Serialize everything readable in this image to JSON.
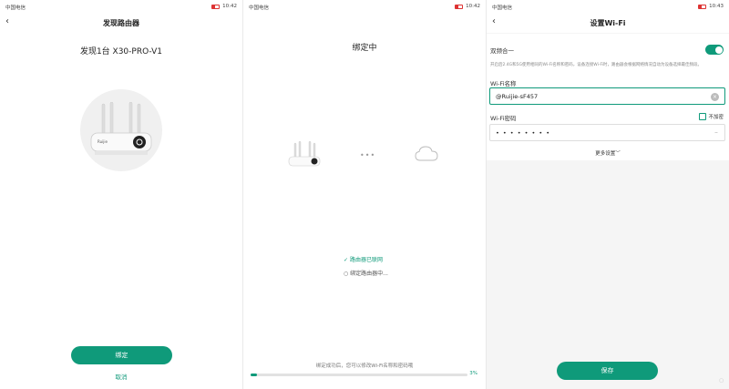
{
  "panel1": {
    "status": {
      "carrier": "中国电信",
      "time": "10:42"
    },
    "title": "发现路由器",
    "found_text": "发现1台 X30-PRO-V1",
    "router_brand": "Ruijie",
    "bind_button": "绑定",
    "cancel_link": "取消"
  },
  "panel2": {
    "status": {
      "carrier": "中国电信",
      "time": "10:42"
    },
    "title": "绑定中",
    "step_done": "路由器已联网",
    "step_pending": "绑定路由器中...",
    "hint": "绑定成功后，您可以修改Wi-Fi名称和密码哦",
    "progress_label": "3%",
    "progress_fraction": 0.03
  },
  "panel3": {
    "status": {
      "carrier": "中国电信",
      "time": "10:43"
    },
    "title": "设置Wi-Fi",
    "dual_band_label": "双频合一",
    "dual_band_on": true,
    "dual_band_desc": "开启后2.4G和5G使用相同的Wi-Fi名称和密码，设备连接Wi-Fi时，路由器会根据网络情况自动为设备选择最佳频段。",
    "wifi_name_label": "Wi-Fi名称",
    "wifi_name_value": "@Ruijie-sF457",
    "wifi_pwd_label": "Wi-Fi密码",
    "no_encrypt_label": "不加密",
    "wifi_pwd_mask": "• • • • • • • •",
    "more_settings": "更多设置",
    "save_button": "保存"
  },
  "colors": {
    "accent": "#0f9a7a"
  }
}
